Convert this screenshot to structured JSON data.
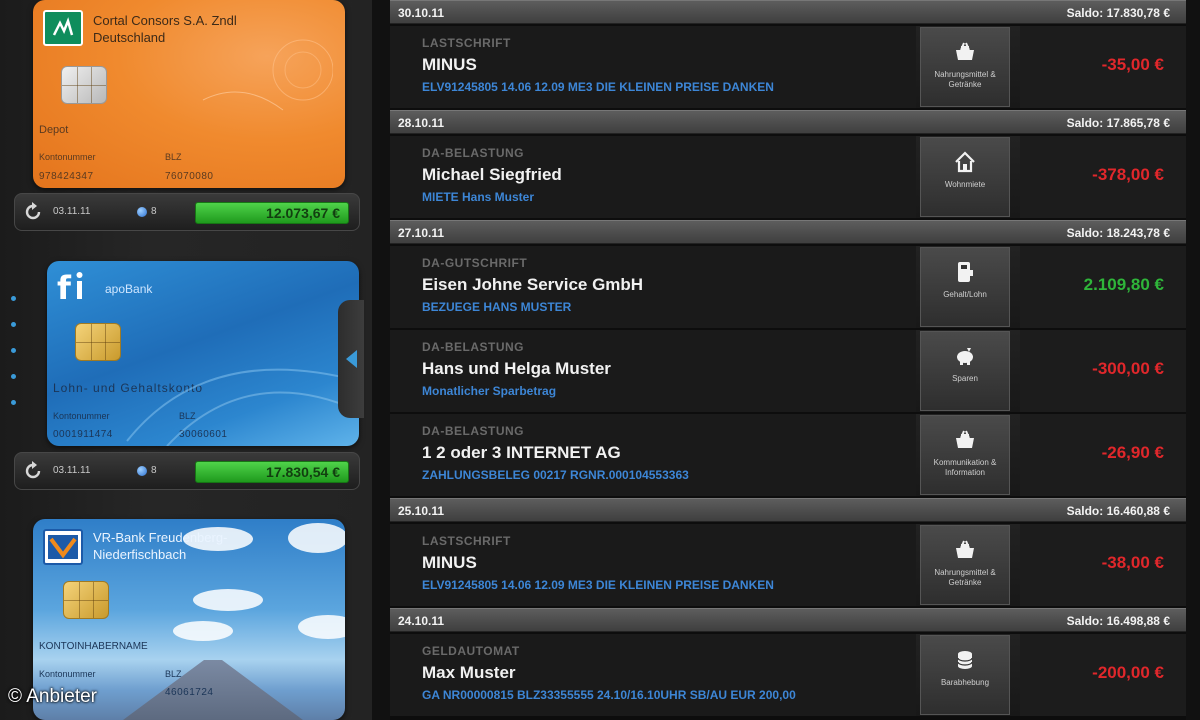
{
  "accounts": [
    {
      "bank_name": "Cortal Consors S.A. Zndl\nDeutschland",
      "account_type": "Depot",
      "kontonummer_label": "Kontonummer",
      "blz_label": "BLZ",
      "kontonummer": "978424347",
      "blz": "76070080",
      "status_date": "03.11.11",
      "status_count": "8",
      "balance": "12.073,67 €"
    },
    {
      "bank_name": "apoBank",
      "account_type": "Lohn- und Gehaltskonto",
      "kontonummer_label": "Kontonummer",
      "blz_label": "BLZ",
      "kontonummer": "0001911474",
      "blz": "30060601",
      "status_date": "03.11.11",
      "status_count": "8",
      "balance": "17.830,54 €"
    },
    {
      "bank_name": "VR-Bank Freudenberg-\nNiederfischbach",
      "account_type": "KONTOINHABERNAME",
      "kontonummer_label": "Kontonummer",
      "blz_label": "BLZ",
      "kontonummer": "",
      "blz": "46061724"
    }
  ],
  "credit": "© Anbieter",
  "transactions": [
    {
      "date": "30.10.11",
      "saldo": "Saldo: 17.830,78 €",
      "items": [
        {
          "type": "LASTSCHRIFT",
          "name": "MINUS",
          "ref": "ELV91245805 14.06 12.09 ME3 DIE KLEINEN PREISE DANKEN",
          "category": "Nahrungsmittel & Getränke",
          "icon": "shopping-basket-icon",
          "amount": "-35,00 €",
          "sign": "neg"
        }
      ]
    },
    {
      "date": "28.10.11",
      "saldo": "Saldo: 17.865,78 €",
      "items": [
        {
          "type": "DA-BELASTUNG",
          "name": "Michael Siegfried",
          "ref": "MIETE Hans Muster",
          "category": "Wohnmiete",
          "icon": "house-icon",
          "amount": "-378,00 €",
          "sign": "neg"
        }
      ]
    },
    {
      "date": "27.10.11",
      "saldo": "Saldo: 18.243,78 €",
      "items": [
        {
          "type": "DA-GUTSCHRIFT",
          "name": "Eisen Johne Service GmbH",
          "ref": "BEZUEGE HANS MUSTER",
          "category": "Gehalt/Lohn",
          "icon": "wallet-icon",
          "amount": "2.109,80 €",
          "sign": "pos"
        },
        {
          "type": "DA-BELASTUNG",
          "name": "Hans und Helga Muster",
          "ref": "Monatlicher Sparbetrag",
          "category": "Sparen",
          "icon": "piggy-bank-icon",
          "amount": "-300,00 €",
          "sign": "neg"
        },
        {
          "type": "DA-BELASTUNG",
          "name": "1 2 oder 3 INTERNET AG",
          "ref": "ZAHLUNGSBELEG 00217 RGNR.000104553363",
          "category": "Kommunikation & Information",
          "icon": "shopping-basket-icon",
          "amount": "-26,90 €",
          "sign": "neg"
        }
      ]
    },
    {
      "date": "25.10.11",
      "saldo": "Saldo: 16.460,88 €",
      "items": [
        {
          "type": "LASTSCHRIFT",
          "name": "MINUS",
          "ref": "ELV91245805 14.06 12.09 ME3 DIE KLEINEN PREISE DANKEN",
          "category": "Nahrungsmittel & Getränke",
          "icon": "shopping-basket-icon",
          "amount": "-38,00 €",
          "sign": "neg"
        }
      ]
    },
    {
      "date": "24.10.11",
      "saldo": "Saldo: 16.498,88 €",
      "items": [
        {
          "type": "GELDAUTOMAT",
          "name": "Max Muster",
          "ref": "GA NR00000815 BLZ33355555 24.10/16.10UHR SB/AU EUR 200,00",
          "category": "Barabhebung",
          "icon": "coin-stack-icon",
          "amount": "-200,00 €",
          "sign": "neg"
        }
      ]
    }
  ],
  "colors": {
    "negative": "#e0272b",
    "positive": "#2fb53a",
    "link": "#3d86d6",
    "balance_pill": "#3cc138"
  }
}
